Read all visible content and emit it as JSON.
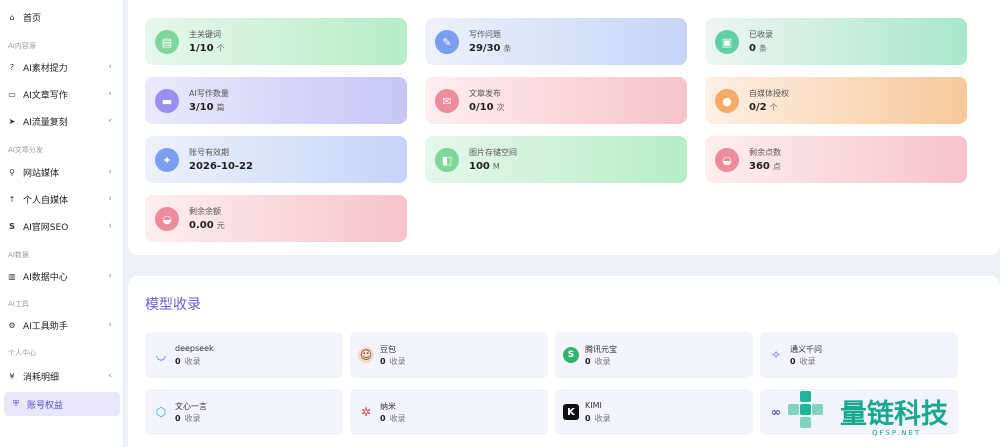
{
  "sidebar": {
    "items": [
      {
        "icon": "home-icon",
        "glyph": "⌂",
        "label": "首页",
        "chevron": false
      },
      {
        "icon": "help-icon",
        "glyph": "?",
        "label": "AI素材提力",
        "chevron": true
      },
      {
        "icon": "folder-icon",
        "glyph": "▭",
        "label": "AI文章写作",
        "chevron": true
      },
      {
        "icon": "send-icon",
        "glyph": "➤",
        "label": "AI流量复刻",
        "chevron": true
      },
      {
        "icon": "search-icon",
        "glyph": "⚲",
        "label": "网站媒体",
        "chevron": true
      },
      {
        "icon": "arrow-up-icon",
        "glyph": "↑",
        "label": "个人自媒体",
        "chevron": true
      },
      {
        "icon": "seo-icon",
        "glyph": "S",
        "label": "AI官网SEO",
        "chevron": true
      },
      {
        "icon": "chart-icon",
        "glyph": "▥",
        "label": "AI数据中心",
        "chevron": true
      },
      {
        "icon": "gear-icon",
        "glyph": "⚙",
        "label": "AI工具助手",
        "chevron": true
      },
      {
        "icon": "yen-icon",
        "glyph": "¥",
        "label": "消耗明细",
        "chevron": true
      },
      {
        "icon": "shield-icon",
        "glyph": "⛨",
        "label": "账号权益",
        "chevron": false
      }
    ],
    "sections": [
      "AI内容源",
      "AI文章分发",
      "AI数据",
      "AI工具",
      "个人中心"
    ]
  },
  "stats": [
    {
      "title": "主关键词",
      "value": "1/10",
      "unit": "个",
      "icon": "document-icon",
      "glyph": "▤",
      "theme": "green"
    },
    {
      "title": "写作问题",
      "value": "29/30",
      "unit": "条",
      "icon": "compass-icon",
      "glyph": "✎",
      "theme": "blue"
    },
    {
      "title": "已收录",
      "value": "0",
      "unit": "条",
      "icon": "wallet-icon",
      "glyph": "▣",
      "theme": "teal"
    },
    {
      "title": "AI写作数量",
      "value": "3/10",
      "unit": "篇",
      "icon": "card-icon",
      "glyph": "▬",
      "theme": "purple"
    },
    {
      "title": "文章发布",
      "value": "0/10",
      "unit": "次",
      "icon": "mail-icon",
      "glyph": "✉",
      "theme": "pink"
    },
    {
      "title": "自媒体授权",
      "value": "0/2",
      "unit": "个",
      "icon": "user-icon",
      "glyph": "●",
      "theme": "orange"
    },
    {
      "title": "账号有效期",
      "value": "2026-10-22",
      "unit": "",
      "icon": "compass-icon",
      "glyph": "✦",
      "theme": "blue"
    },
    {
      "title": "图片存储空间",
      "value": "100",
      "unit": "M",
      "icon": "storage-icon",
      "glyph": "◧",
      "theme": "green"
    },
    {
      "title": "剩余点数",
      "value": "360",
      "unit": "点",
      "icon": "basket-icon",
      "glyph": "◒",
      "theme": "pink"
    },
    {
      "title": "剩余余额",
      "value": "0.00",
      "unit": "元",
      "icon": "basket-icon",
      "glyph": "◒",
      "theme": "pink"
    }
  ],
  "models_section": {
    "title": "模型收录"
  },
  "models": [
    {
      "name": "deepseek",
      "count": "0",
      "unit": "收录",
      "icon": "deepseek-icon",
      "glyph": "◡",
      "color": "#4d6bfe",
      "bg": "transparent"
    },
    {
      "name": "豆包",
      "count": "0",
      "unit": "收录",
      "icon": "doubao-icon",
      "glyph": "☺",
      "color": "#7a4b2a",
      "bg": "#f4dccc"
    },
    {
      "name": "腾讯元宝",
      "count": "0",
      "unit": "收录",
      "icon": "yuanbao-icon",
      "glyph": "S",
      "color": "#ffffff",
      "bg": "#2fb66c"
    },
    {
      "name": "通义千问",
      "count": "0",
      "unit": "收录",
      "icon": "qwen-icon",
      "glyph": "✧",
      "color": "#6f5ce6",
      "bg": "transparent"
    },
    {
      "name": "文心一言",
      "count": "0",
      "unit": "收录",
      "icon": "wenxin-icon",
      "glyph": "⬡",
      "color": "#3aa0e8",
      "bg": "transparent"
    },
    {
      "name": "纳米",
      "count": "0",
      "unit": "收录",
      "icon": "nami-icon",
      "glyph": "✲",
      "color": "#e8465a",
      "bg": "transparent"
    },
    {
      "name": "KIMI",
      "count": "0",
      "unit": "收录",
      "icon": "kimi-icon",
      "glyph": "K",
      "color": "#ffffff",
      "bg": "#111111"
    },
    {
      "name": "",
      "count": "",
      "unit": "",
      "icon": "partial-model-icon",
      "glyph": "∞",
      "color": "#5a4fd6",
      "bg": "transparent"
    }
  ],
  "watermark": {
    "brand": "量链科技",
    "domain": "QFSP.NET"
  }
}
